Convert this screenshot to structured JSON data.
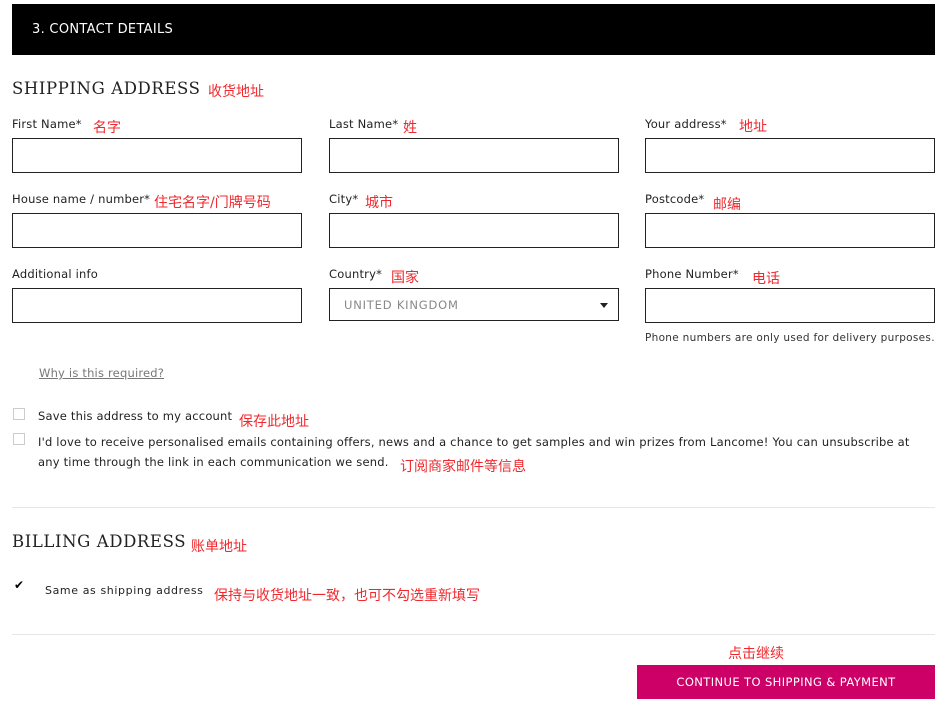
{
  "header": {
    "title": "3. CONTACT DETAILS"
  },
  "shipping": {
    "title": "SHIPPING ADDRESS",
    "title_note": "收货地址",
    "fields": {
      "first_name": {
        "label": "First Name*",
        "note": "名字",
        "value": ""
      },
      "last_name": {
        "label": "Last Name*",
        "note": "姓",
        "value": ""
      },
      "address": {
        "label": "Your address*",
        "note": "地址",
        "value": ""
      },
      "house": {
        "label": "House name / number*",
        "note": "住宅名字/门牌号码",
        "value": ""
      },
      "city": {
        "label": "City*",
        "note": "城市",
        "value": ""
      },
      "postcode": {
        "label": "Postcode*",
        "note": "邮编",
        "value": ""
      },
      "additional": {
        "label": "Additional info",
        "value": ""
      },
      "country": {
        "label": "Country*",
        "note": "国家",
        "selected": "UNITED KINGDOM"
      },
      "phone": {
        "label": "Phone Number*",
        "note": "电话",
        "value": "",
        "helper": "Phone numbers are only used for delivery purposes."
      }
    },
    "why_link": "Why is this required?",
    "save_address": {
      "label": "Save this address to my account",
      "note": "保存此地址",
      "checked": false
    },
    "newsletter": {
      "line1": "I'd love to receive personalised emails containing offers, news and a chance to get samples and win prizes from Lancome! You can unsubscribe at",
      "line2": "any time through the link in each communication we send.",
      "note": "订阅商家邮件等信息",
      "checked": false
    }
  },
  "billing": {
    "title": "BILLING ADDRESS",
    "title_note": "账单地址",
    "same_as_shipping": {
      "label": "Same as shipping address",
      "note": "保持与收货地址一致，也可不勾选重新填写",
      "checked": true
    }
  },
  "cta": {
    "label": "CONTINUE TO SHIPPING & PAYMENT",
    "note": "点击继续",
    "color": "#cc0066"
  }
}
